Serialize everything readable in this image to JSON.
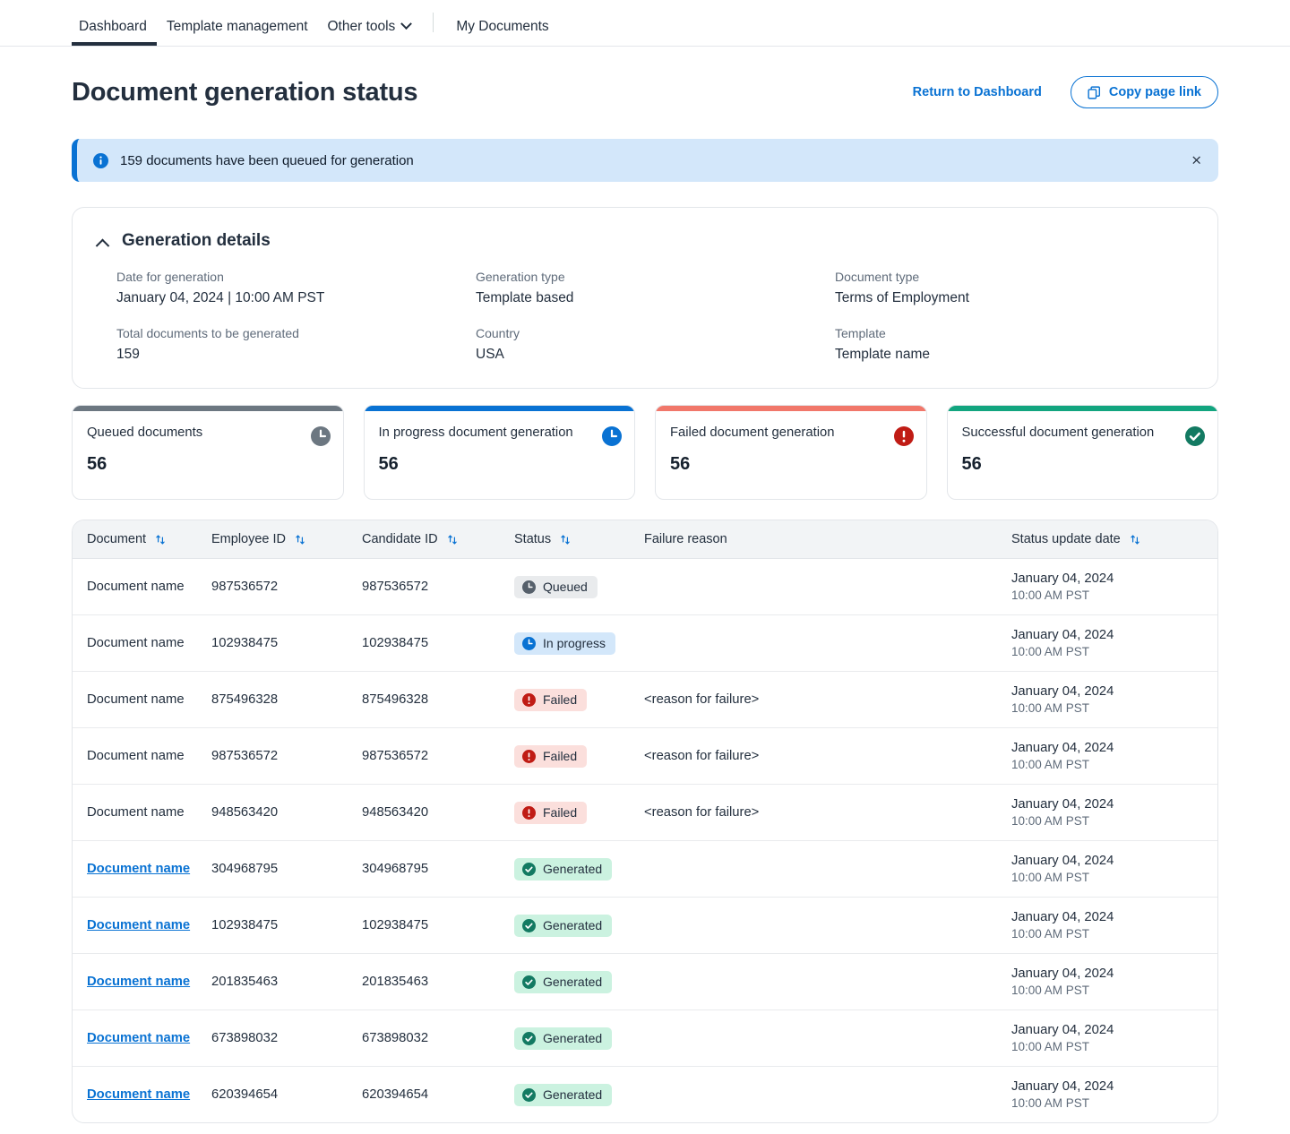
{
  "nav": {
    "items": [
      {
        "label": "Dashboard",
        "active": true,
        "caret": false
      },
      {
        "label": "Template management",
        "active": false,
        "caret": false
      },
      {
        "label": "Other tools",
        "active": false,
        "caret": true
      }
    ],
    "secondary": {
      "label": "My Documents"
    }
  },
  "header": {
    "title": "Document generation status",
    "return_link": "Return to Dashboard",
    "copy_button": "Copy page link"
  },
  "alert": {
    "message": "159 documents have been queued for generation",
    "close_label": "×",
    "accent_color": "#0972d3",
    "background": "#d3e7fa"
  },
  "details": {
    "title": "Generation details",
    "fields": [
      {
        "label": "Date for generation",
        "value": "January 04, 2024 | 10:00 AM PST"
      },
      {
        "label": "Generation type",
        "value": "Template based"
      },
      {
        "label": "Document type",
        "value": "Terms of Employment"
      },
      {
        "label": "Total documents to be generated",
        "value": "159"
      },
      {
        "label": "Country",
        "value": "USA"
      },
      {
        "label": "Template",
        "value": "Template name"
      }
    ]
  },
  "cards": [
    {
      "label": "Queued documents",
      "value": "56",
      "bar_color": "#6c7781",
      "icon_color": "#6c7781",
      "icon": "clock-icon"
    },
    {
      "label": "In progress document generation",
      "value": "56",
      "bar_color": "#0972d3",
      "icon_color": "#0972d3",
      "icon": "clock-icon"
    },
    {
      "label": "Failed document generation",
      "value": "56",
      "bar_color": "#f1776a",
      "icon_color": "#c01c15",
      "icon": "error-icon"
    },
    {
      "label": "Successful document generation",
      "value": "56",
      "bar_color": "#12a57f",
      "icon_color": "#137a62",
      "icon": "check-circle-icon"
    }
  ],
  "table": {
    "columns": [
      {
        "label": "Document",
        "sortable": true
      },
      {
        "label": "Employee ID",
        "sortable": true
      },
      {
        "label": "Candidate ID",
        "sortable": true
      },
      {
        "label": "Status",
        "sortable": true
      },
      {
        "label": "Failure reason",
        "sortable": false
      },
      {
        "label": "Status update date",
        "sortable": true
      }
    ],
    "rows": [
      {
        "document": "Document name",
        "is_link": false,
        "employee_id": "987536572",
        "candidate_id": "987536572",
        "status": "Queued",
        "status_kind": "queued",
        "failure_reason": "",
        "date": "January 04, 2024",
        "time": "10:00 AM PST"
      },
      {
        "document": "Document name",
        "is_link": false,
        "employee_id": "102938475",
        "candidate_id": "102938475",
        "status": "In progress",
        "status_kind": "inprogress",
        "failure_reason": "",
        "date": "January 04, 2024",
        "time": "10:00 AM PST"
      },
      {
        "document": "Document name",
        "is_link": false,
        "employee_id": "875496328",
        "candidate_id": "875496328",
        "status": "Failed",
        "status_kind": "failed",
        "failure_reason": "<reason for failure>",
        "date": "January 04, 2024",
        "time": "10:00 AM PST"
      },
      {
        "document": "Document name",
        "is_link": false,
        "employee_id": "987536572",
        "candidate_id": "987536572",
        "status": "Failed",
        "status_kind": "failed",
        "failure_reason": "<reason for failure>",
        "date": "January 04, 2024",
        "time": "10:00 AM PST"
      },
      {
        "document": "Document name",
        "is_link": false,
        "employee_id": "948563420",
        "candidate_id": "948563420",
        "status": "Failed",
        "status_kind": "failed",
        "failure_reason": "<reason for failure>",
        "date": "January 04, 2024",
        "time": "10:00 AM PST"
      },
      {
        "document": "Document name",
        "is_link": true,
        "employee_id": "304968795",
        "candidate_id": "304968795",
        "status": "Generated",
        "status_kind": "generated",
        "failure_reason": "",
        "date": "January 04, 2024",
        "time": "10:00 AM PST"
      },
      {
        "document": "Document name",
        "is_link": true,
        "employee_id": "102938475",
        "candidate_id": "102938475",
        "status": "Generated",
        "status_kind": "generated",
        "failure_reason": "",
        "date": "January 04, 2024",
        "time": "10:00 AM PST"
      },
      {
        "document": "Document name",
        "is_link": true,
        "employee_id": "201835463",
        "candidate_id": "201835463",
        "status": "Generated",
        "status_kind": "generated",
        "failure_reason": "",
        "date": "January 04, 2024",
        "time": "10:00 AM PST"
      },
      {
        "document": "Document name",
        "is_link": true,
        "employee_id": "673898032",
        "candidate_id": "673898032",
        "status": "Generated",
        "status_kind": "generated",
        "failure_reason": "",
        "date": "January 04, 2024",
        "time": "10:00 AM PST"
      },
      {
        "document": "Document name",
        "is_link": true,
        "employee_id": "620394654",
        "candidate_id": "620394654",
        "status": "Generated",
        "status_kind": "generated",
        "failure_reason": "",
        "date": "January 04, 2024",
        "time": "10:00 AM PST"
      }
    ],
    "status_styles": {
      "queued": {
        "bg": "#e9ebed",
        "fg": "#232f3e",
        "icon_color": "#56606b",
        "icon": "clock-icon"
      },
      "inprogress": {
        "bg": "#d3e7fa",
        "fg": "#232f3e",
        "icon_color": "#0972d3",
        "icon": "clock-icon"
      },
      "failed": {
        "bg": "#fbdfdc",
        "fg": "#232f3e",
        "icon_color": "#c01c15",
        "icon": "error-icon"
      },
      "generated": {
        "bg": "#cbf2e0",
        "fg": "#232f3e",
        "icon_color": "#137a62",
        "icon": "check-circle-icon"
      }
    }
  }
}
